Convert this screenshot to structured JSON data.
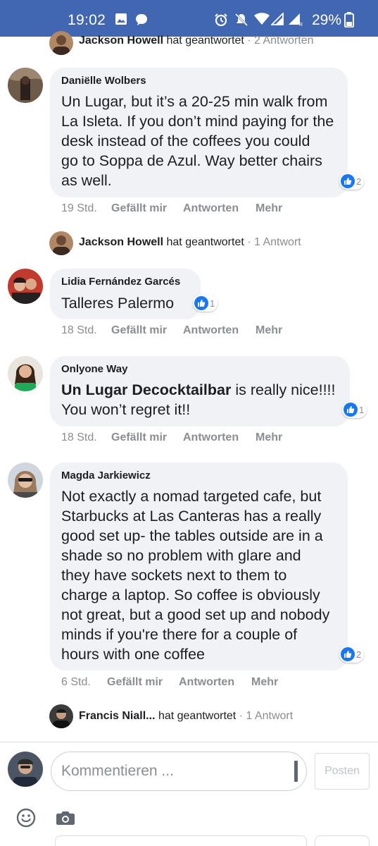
{
  "status_bar": {
    "time": "19:02",
    "battery": "29%"
  },
  "replies_top": {
    "name": "Jackson Howell",
    "action": "hat geantwortet",
    "count": "· 2 Antworten"
  },
  "comments": [
    {
      "author": "Daniëlle Wolbers",
      "text_lines": [
        "Un Lugar, but it’s a 20-25 min walk from",
        "La Isleta. If you don’t mind paying for the",
        "desk instead of the coffees you could",
        "go to Soppa de Azul. Way better chairs",
        "as well."
      ],
      "reactions": "2",
      "time": "19 Std.",
      "like": "Gefällt mir",
      "reply": "Antworten",
      "more": "Mehr",
      "reply_notice": {
        "name": "Jackson Howell",
        "action": "hat geantwortet",
        "count": "· 1 Antwort"
      }
    },
    {
      "author": "Lidia Fernández Garcés",
      "text_lines": [
        "Talleres Palermo"
      ],
      "reactions": "1",
      "time": "18 Std.",
      "like": "Gefällt mir",
      "reply": "Antworten",
      "more": "Mehr"
    },
    {
      "author": "Onlyone Way",
      "text_bold": "Un Lugar Decocktailbar",
      "text_line1_rest": " is really nice!!!!",
      "text_line2": "You won’t regret it!!",
      "reactions": "1",
      "time": "18 Std.",
      "like": "Gefällt mir",
      "reply": "Antworten",
      "more": "Mehr"
    },
    {
      "author": "Magda Jarkiewicz",
      "text_lines": [
        "Not exactly a nomad targeted cafe, but",
        "Starbucks at Las Canteras has a really",
        "good set up- the tables outside are in a",
        "shade so no problem with glare and",
        "they have sockets next to them to",
        "charge a laptop. So coffee is obviously",
        "not great, but a good set up and nobody",
        "minds if you're there for a couple of",
        "hours with one coffee"
      ],
      "reactions": "2",
      "time": "6 Std.",
      "like": "Gefällt mir",
      "reply": "Antworten",
      "more": "Mehr",
      "reply_notice": {
        "name": "Francis Niall...",
        "action": "hat geantwortet",
        "count": "· 1 Antwort"
      }
    }
  ],
  "composer": {
    "placeholder": "Kommentieren ...",
    "post_label": "Posten"
  },
  "icons": {
    "like": "thumbs-up-icon",
    "emoji": "smiley-icon",
    "camera": "camera-icon"
  },
  "colors": {
    "status_bar": "#4267b2",
    "like_blue": "#1877f2",
    "bubble": "#f0f2f5",
    "meta_grey": "#8a8d91"
  }
}
